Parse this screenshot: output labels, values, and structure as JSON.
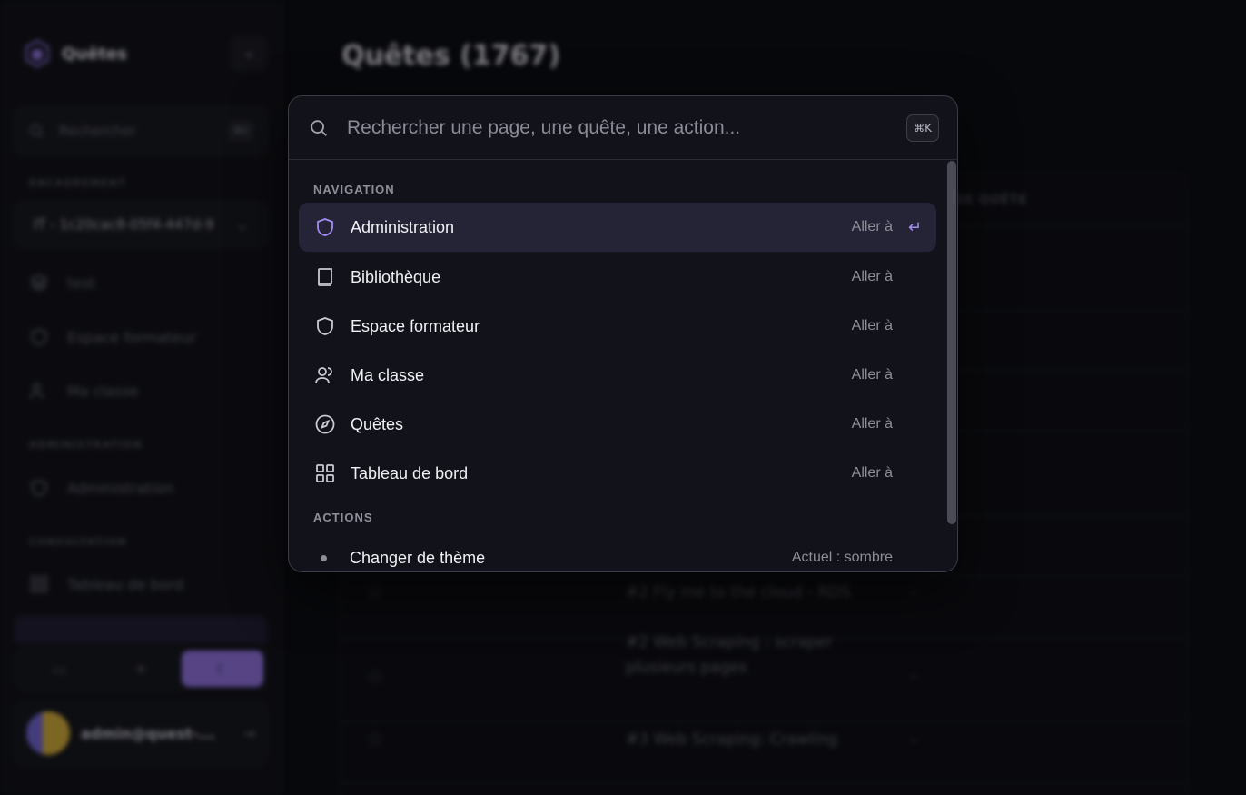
{
  "sidebar": {
    "app_name": "Quêtes",
    "search": {
      "placeholder": "Rechercher",
      "shortcut": "⌘K"
    },
    "sections": {
      "encadrement": "ENCADREMENT",
      "administration": "ADMINISTRATION",
      "consultation": "CONSULTATION"
    },
    "selector_value": "IT - 1c20cac8-05f4-447d-9",
    "items": {
      "test": "test",
      "espace_formateur": "Espace formateur",
      "ma_classe": "Ma classe",
      "administration": "Administration",
      "tableau_de_bord": "Tableau de bord"
    },
    "user_email": "admin@quest-..."
  },
  "main": {
    "title": "Quêtes (1767)",
    "table_header": "DE QUÊTE",
    "rows": [
      {
        "name": "#2 Fly me to the cloud - RDS",
        "value": "-"
      },
      {
        "name": "#2 Web Scraping : scraper plusieurs pages",
        "value": "-"
      },
      {
        "name": "#3 Web Scraping: Crawling",
        "value": "-"
      }
    ]
  },
  "palette": {
    "placeholder": "Rechercher une page, une quête, une action...",
    "shortcut": "⌘K",
    "groups": {
      "navigation": "NAVIGATION",
      "actions": "ACTIONS"
    },
    "navigation": [
      {
        "label": "Administration",
        "hint": "Aller à",
        "icon": "shield-icon"
      },
      {
        "label": "Bibliothèque",
        "hint": "Aller à",
        "icon": "book-icon"
      },
      {
        "label": "Espace formateur",
        "hint": "Aller à",
        "icon": "shield-icon"
      },
      {
        "label": "Ma classe",
        "hint": "Aller à",
        "icon": "users-icon"
      },
      {
        "label": "Quêtes",
        "hint": "Aller à",
        "icon": "compass-icon"
      },
      {
        "label": "Tableau de bord",
        "hint": "Aller à",
        "icon": "grid-icon"
      }
    ],
    "actions": [
      {
        "label": "Changer de thème",
        "hint": "Actuel : sombre"
      }
    ],
    "enter_glyph": "↵"
  },
  "colors": {
    "accent": "#8b6fd6",
    "active_row": "#252436",
    "background": "#0c0d12"
  }
}
